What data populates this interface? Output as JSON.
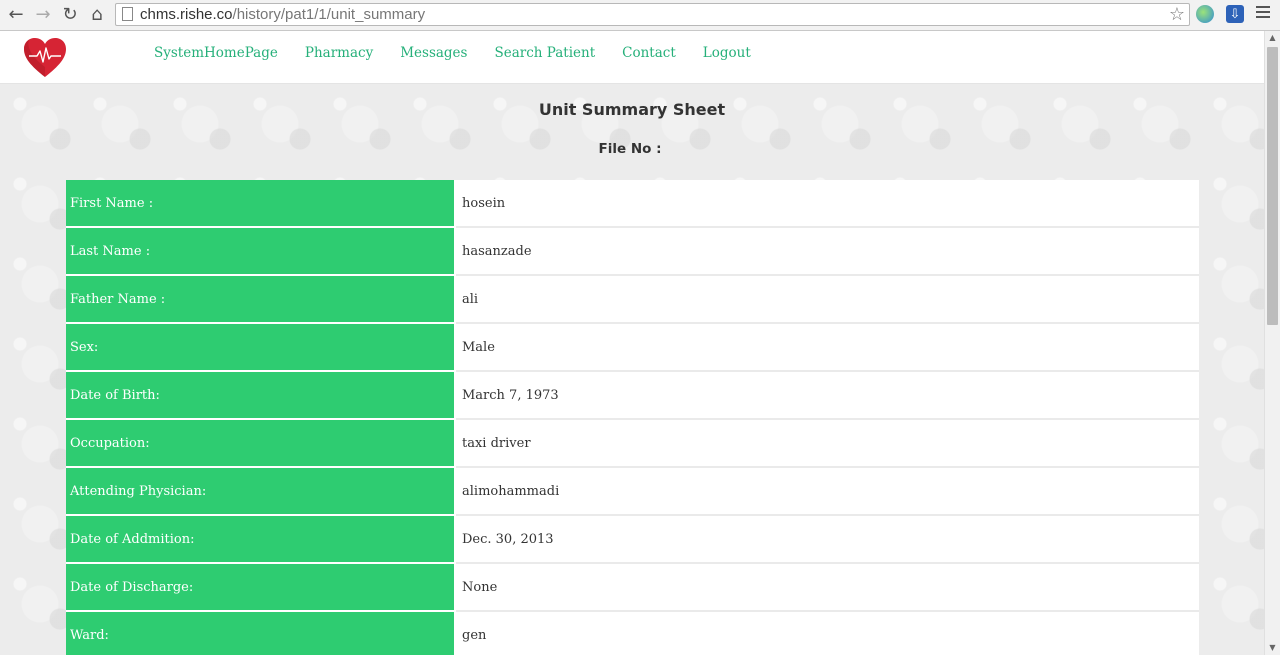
{
  "browser": {
    "url_host": "chms.rishe.co",
    "url_path": "/history/pat1/1/unit_summary"
  },
  "nav": {
    "items": [
      "SystemHomePage",
      "Pharmacy",
      "Messages",
      "Search Patient",
      "Contact",
      "Logout"
    ]
  },
  "page": {
    "title": "Unit Summary Sheet",
    "file_no_label": "File No :",
    "file_no_value": ""
  },
  "summary": {
    "rows": [
      {
        "label": "First Name :",
        "value": "hosein"
      },
      {
        "label": "Last Name :",
        "value": "hasanzade"
      },
      {
        "label": "Father Name :",
        "value": "ali"
      },
      {
        "label": "Sex:",
        "value": "Male"
      },
      {
        "label": "Date of Birth:",
        "value": "March 7, 1973"
      },
      {
        "label": "Occupation:",
        "value": "taxi driver"
      },
      {
        "label": "Attending Physician:",
        "value": "alimohammadi"
      },
      {
        "label": "Date of Addmition:",
        "value": "Dec. 30, 2013"
      },
      {
        "label": "Date of Discharge:",
        "value": "None"
      },
      {
        "label": "Ward:",
        "value": "gen"
      }
    ]
  },
  "colors": {
    "accent_green": "#2ecc71",
    "nav_link": "#26b07a",
    "logo_red": "#d62434"
  },
  "icons": {
    "back": "back-arrow-icon",
    "forward": "forward-arrow-icon",
    "reload": "reload-icon",
    "home": "home-icon",
    "bookmark": "star-icon",
    "menu": "hamburger-menu-icon",
    "logo": "heart-pulse-logo"
  }
}
